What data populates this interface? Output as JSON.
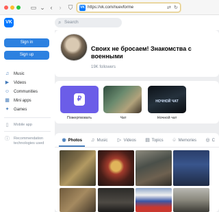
{
  "browser": {
    "url": "https://vk.com/nuevforme"
  },
  "vk": {
    "logo": "VK",
    "search_placeholder": "Search"
  },
  "sidebar": {
    "sign_in": "Sign in",
    "sign_up": "Sign up",
    "items": [
      {
        "label": "Music",
        "icon": "music-icon"
      },
      {
        "label": "Videos",
        "icon": "video-icon"
      },
      {
        "label": "Communities",
        "icon": "communities-icon"
      },
      {
        "label": "Mini apps",
        "icon": "mini-apps-icon"
      },
      {
        "label": "Games",
        "icon": "games-icon"
      }
    ],
    "mobile_app": "Mobile app",
    "recommendation": "Recommendation technologies used"
  },
  "profile": {
    "title": "Своих не бросаем! Знакомства с военными",
    "followers": "19K followers"
  },
  "apps": [
    {
      "label": "Пожертвовать"
    },
    {
      "label": "Чат"
    },
    {
      "label": "Ночной чат",
      "overlay": "НОЧНОЙ ЧАТ"
    }
  ],
  "tabs": [
    {
      "label": "Photos",
      "icon": "photo-icon",
      "active": true
    },
    {
      "label": "Music",
      "icon": "music-icon",
      "active": false
    },
    {
      "label": "Videos",
      "icon": "video-icon",
      "active": false
    },
    {
      "label": "Topics",
      "icon": "topics-icon",
      "active": false
    },
    {
      "label": "Memories",
      "icon": "memories-icon",
      "active": false
    },
    {
      "label": "C",
      "icon": "clips-icon",
      "active": false
    }
  ],
  "colors": {
    "accent": "#2d81e0",
    "vk_blue": "#0077ff",
    "donate_purple": "#6b5de8",
    "background": "#edeef0"
  }
}
